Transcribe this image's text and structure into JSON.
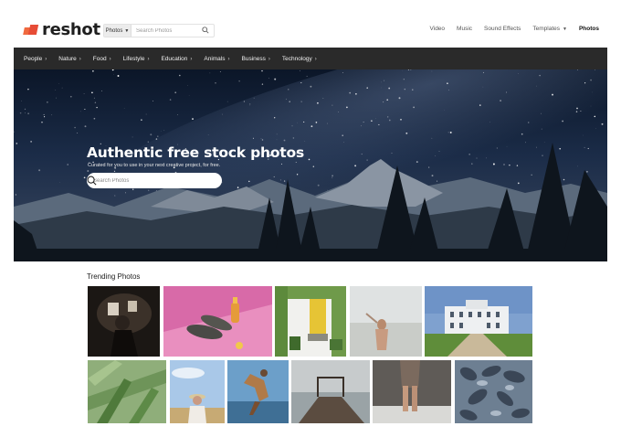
{
  "header": {
    "logo_text": "reshot",
    "search": {
      "type_label": "Photos",
      "placeholder": "Search Photos"
    },
    "nav": [
      {
        "label": "Video"
      },
      {
        "label": "Music"
      },
      {
        "label": "Sound Effects"
      },
      {
        "label": "Templates"
      },
      {
        "label": "Photos"
      }
    ]
  },
  "categories": [
    {
      "label": "People"
    },
    {
      "label": "Nature"
    },
    {
      "label": "Food"
    },
    {
      "label": "Lifestyle"
    },
    {
      "label": "Education"
    },
    {
      "label": "Animals"
    },
    {
      "label": "Business"
    },
    {
      "label": "Technology"
    }
  ],
  "hero": {
    "title": "Authentic free stock photos",
    "subtitle": "Curated for you to use in your next creative project, for free.",
    "search_placeholder": "Search Photos"
  },
  "trending": {
    "title": "Trending Photos"
  },
  "colors": {
    "brand_accent": "#e74c36",
    "category_bar": "#2a2a2a"
  }
}
